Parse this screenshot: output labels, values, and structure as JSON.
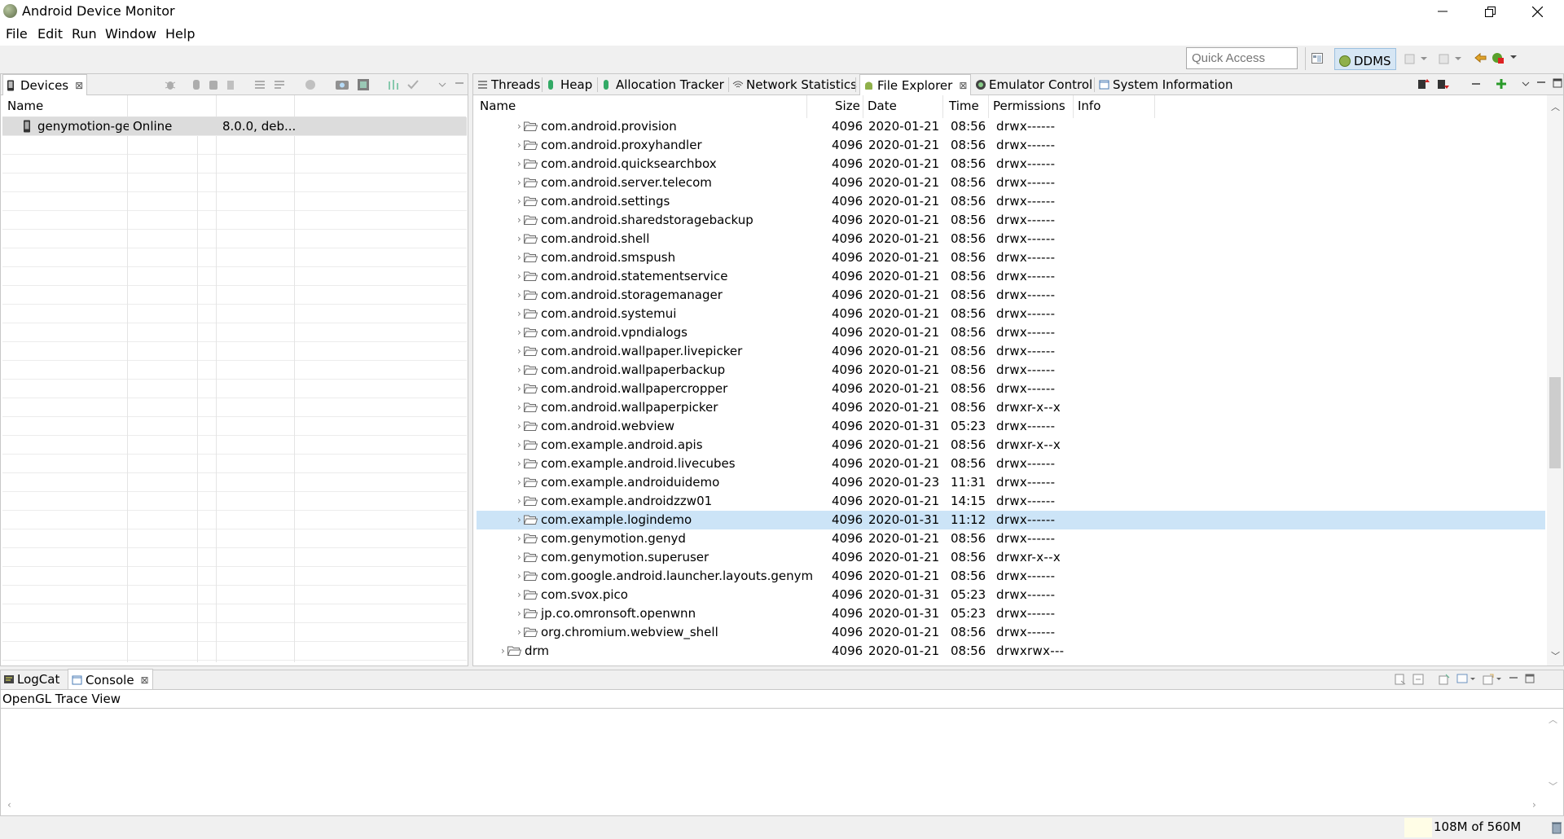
{
  "window": {
    "title": "Android Device Monitor"
  },
  "menu": [
    "File",
    "Edit",
    "Run",
    "Window",
    "Help"
  ],
  "toolbar": {
    "quick_access_placeholder": "Quick Access",
    "perspective": "DDMS"
  },
  "devices": {
    "tab_label": "Devices",
    "column_name": "Name",
    "rows": [
      {
        "name": "genymotion-ge",
        "status": "Online",
        "info": "8.0.0, deb..."
      }
    ]
  },
  "right_tabs": [
    "Threads",
    "Heap",
    "Allocation Tracker",
    "Network Statistics",
    "File Explorer",
    "Emulator Control",
    "System Information"
  ],
  "file_explorer": {
    "columns": {
      "name": "Name",
      "size": "Size",
      "date": "Date",
      "time": "Time",
      "permissions": "Permissions",
      "info": "Info"
    },
    "rows": [
      {
        "name": "com.android.provision",
        "size": "4096",
        "date": "2020-01-21",
        "time": "08:56",
        "perm": "drwx------"
      },
      {
        "name": "com.android.proxyhandler",
        "size": "4096",
        "date": "2020-01-21",
        "time": "08:56",
        "perm": "drwx------"
      },
      {
        "name": "com.android.quicksearchbox",
        "size": "4096",
        "date": "2020-01-21",
        "time": "08:56",
        "perm": "drwx------"
      },
      {
        "name": "com.android.server.telecom",
        "size": "4096",
        "date": "2020-01-21",
        "time": "08:56",
        "perm": "drwx------"
      },
      {
        "name": "com.android.settings",
        "size": "4096",
        "date": "2020-01-21",
        "time": "08:56",
        "perm": "drwx------"
      },
      {
        "name": "com.android.sharedstoragebackup",
        "size": "4096",
        "date": "2020-01-21",
        "time": "08:56",
        "perm": "drwx------"
      },
      {
        "name": "com.android.shell",
        "size": "4096",
        "date": "2020-01-21",
        "time": "08:56",
        "perm": "drwx------"
      },
      {
        "name": "com.android.smspush",
        "size": "4096",
        "date": "2020-01-21",
        "time": "08:56",
        "perm": "drwx------"
      },
      {
        "name": "com.android.statementservice",
        "size": "4096",
        "date": "2020-01-21",
        "time": "08:56",
        "perm": "drwx------"
      },
      {
        "name": "com.android.storagemanager",
        "size": "4096",
        "date": "2020-01-21",
        "time": "08:56",
        "perm": "drwx------"
      },
      {
        "name": "com.android.systemui",
        "size": "4096",
        "date": "2020-01-21",
        "time": "08:56",
        "perm": "drwx------"
      },
      {
        "name": "com.android.vpndialogs",
        "size": "4096",
        "date": "2020-01-21",
        "time": "08:56",
        "perm": "drwx------"
      },
      {
        "name": "com.android.wallpaper.livepicker",
        "size": "4096",
        "date": "2020-01-21",
        "time": "08:56",
        "perm": "drwx------"
      },
      {
        "name": "com.android.wallpaperbackup",
        "size": "4096",
        "date": "2020-01-21",
        "time": "08:56",
        "perm": "drwx------"
      },
      {
        "name": "com.android.wallpapercropper",
        "size": "4096",
        "date": "2020-01-21",
        "time": "08:56",
        "perm": "drwx------"
      },
      {
        "name": "com.android.wallpaperpicker",
        "size": "4096",
        "date": "2020-01-21",
        "time": "08:56",
        "perm": "drwxr-x--x"
      },
      {
        "name": "com.android.webview",
        "size": "4096",
        "date": "2020-01-31",
        "time": "05:23",
        "perm": "drwx------"
      },
      {
        "name": "com.example.android.apis",
        "size": "4096",
        "date": "2020-01-21",
        "time": "08:56",
        "perm": "drwxr-x--x"
      },
      {
        "name": "com.example.android.livecubes",
        "size": "4096",
        "date": "2020-01-21",
        "time": "08:56",
        "perm": "drwx------"
      },
      {
        "name": "com.example.androiduidemo",
        "size": "4096",
        "date": "2020-01-23",
        "time": "11:31",
        "perm": "drwx------"
      },
      {
        "name": "com.example.androidzzw01",
        "size": "4096",
        "date": "2020-01-21",
        "time": "14:15",
        "perm": "drwx------"
      },
      {
        "name": "com.example.logindemo",
        "size": "4096",
        "date": "2020-01-31",
        "time": "11:12",
        "perm": "drwx------"
      },
      {
        "name": "com.genymotion.genyd",
        "size": "4096",
        "date": "2020-01-21",
        "time": "08:56",
        "perm": "drwx------"
      },
      {
        "name": "com.genymotion.superuser",
        "size": "4096",
        "date": "2020-01-21",
        "time": "08:56",
        "perm": "drwxr-x--x"
      },
      {
        "name": "com.google.android.launcher.layouts.genym",
        "size": "4096",
        "date": "2020-01-21",
        "time": "08:56",
        "perm": "drwx------"
      },
      {
        "name": "com.svox.pico",
        "size": "4096",
        "date": "2020-01-31",
        "time": "05:23",
        "perm": "drwx------"
      },
      {
        "name": "jp.co.omronsoft.openwnn",
        "size": "4096",
        "date": "2020-01-31",
        "time": "05:23",
        "perm": "drwx------"
      },
      {
        "name": "org.chromium.webview_shell",
        "size": "4096",
        "date": "2020-01-21",
        "time": "08:56",
        "perm": "drwx------"
      },
      {
        "name": "drm",
        "size": "4096",
        "date": "2020-01-21",
        "time": "08:56",
        "perm": "drwxrwx---"
      }
    ]
  },
  "bottom": {
    "tabs": [
      "LogCat",
      "Console"
    ],
    "console_title": "OpenGL Trace View"
  },
  "status": {
    "memory": "108M of 560M"
  }
}
